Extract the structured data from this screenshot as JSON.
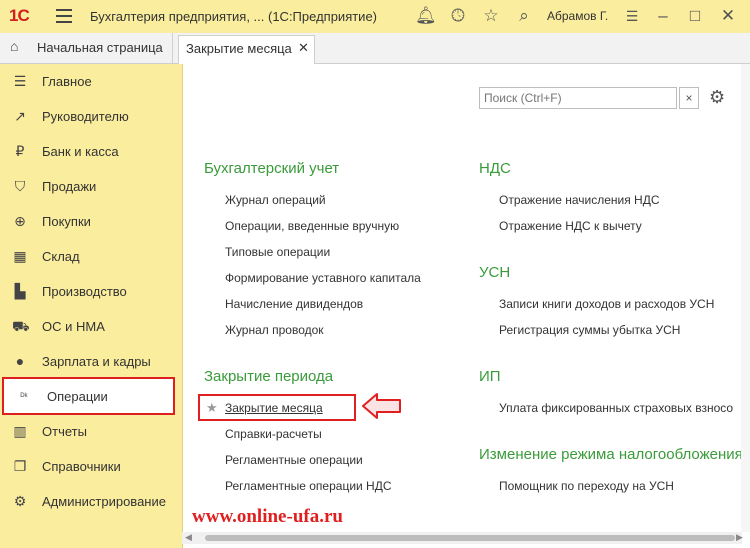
{
  "app": {
    "logo": "1С",
    "title": "Бухгалтерия предприятия, ...  (1С:Предприятие)",
    "user": "Абрамов Г."
  },
  "tabs": {
    "home": "Начальная страница",
    "active": "Закрытие месяца",
    "close_glyph": "✕"
  },
  "sidebar": {
    "items": [
      {
        "label": "Главное",
        "icon": "menu-list-icon"
      },
      {
        "label": "Руководителю",
        "icon": "trend-icon"
      },
      {
        "label": "Банк и касса",
        "icon": "ruble-coin-icon"
      },
      {
        "label": "Продажи",
        "icon": "shopping-bag-icon"
      },
      {
        "label": "Покупки",
        "icon": "cart-icon"
      },
      {
        "label": "Склад",
        "icon": "warehouse-icon"
      },
      {
        "label": "Производство",
        "icon": "factory-icon"
      },
      {
        "label": "ОС и НМА",
        "icon": "truck-icon"
      },
      {
        "label": "Зарплата и кадры",
        "icon": "person-icon"
      },
      {
        "label": "Операции",
        "icon": "dt-kt-icon"
      },
      {
        "label": "Отчеты",
        "icon": "bar-chart-icon"
      },
      {
        "label": "Справочники",
        "icon": "books-icon"
      },
      {
        "label": "Администрирование",
        "icon": "gear-icon"
      }
    ]
  },
  "search": {
    "placeholder": "Поиск (Ctrl+F)",
    "clear_glyph": "×"
  },
  "sections": {
    "accounting": {
      "title": "Бухгалтерский учет",
      "items": [
        "Журнал операций",
        "Операции, введенные вручную",
        "Типовые операции",
        "Формирование уставного капитала",
        "Начисление дивидендов",
        "Журнал проводок"
      ]
    },
    "period": {
      "title": "Закрытие периода",
      "items": [
        "Закрытие месяца",
        "Справки-расчеты",
        "Регламентные операции",
        "Регламентные операции НДС"
      ]
    },
    "vat": {
      "title": "НДС",
      "items": [
        "Отражение начисления НДС",
        "Отражение НДС к вычету"
      ]
    },
    "usn": {
      "title": "УСН",
      "items": [
        "Записи книги доходов и расходов УСН",
        "Регистрация суммы убытка УСН"
      ]
    },
    "ip": {
      "title": "ИП",
      "items": [
        "Уплата фиксированных страховых взносо"
      ]
    },
    "tax_mode": {
      "title": "Изменение режима налогообложения",
      "items": [
        "Помощник по переходу на УСН"
      ]
    }
  },
  "watermark": "www.online-ufa.ru",
  "colors": {
    "sidebar_bg": "#fbed9e",
    "section_title": "#3a9b3a",
    "highlight": "#e02020"
  }
}
